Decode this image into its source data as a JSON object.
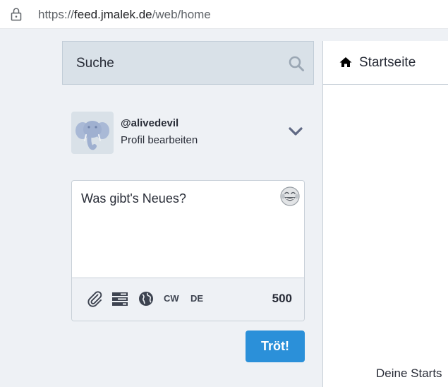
{
  "browser": {
    "url_prefix": "https://",
    "url_host": "feed.jmalek.de",
    "url_path": "/web/home"
  },
  "search": {
    "placeholder": "Suche"
  },
  "account": {
    "handle": "@alivedevil",
    "edit_label": "Profil bearbeiten"
  },
  "compose": {
    "placeholder": "Was gibt's Neues?",
    "cw_label": "CW",
    "language_label": "DE",
    "char_count": "500",
    "submit_label": "Tröt!"
  },
  "column": {
    "title": "Startseite",
    "empty_message": "Deine Starts"
  },
  "colors": {
    "accent": "#2b90d9",
    "background": "#eef1f5",
    "search_bg": "#d9e1e8"
  },
  "icons": [
    "lock-icon",
    "search-icon",
    "chevron-down-icon",
    "emoji-icon",
    "paperclip-icon",
    "poll-icon",
    "globe-icon",
    "home-icon"
  ]
}
